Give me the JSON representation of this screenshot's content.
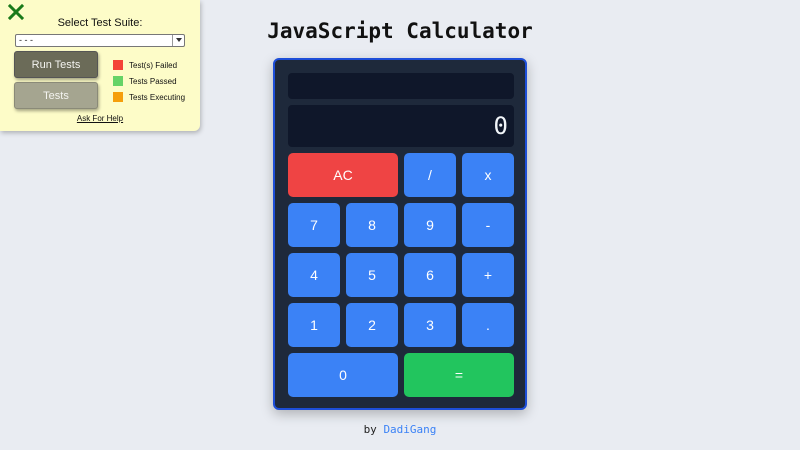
{
  "test_panel": {
    "title": "Select Test Suite:",
    "select_value": "- - -",
    "run_button": "Run Tests",
    "tests_button": "Tests",
    "legend": [
      {
        "label": "Test(s) Failed",
        "color": "#f44336"
      },
      {
        "label": "Tests Passed",
        "color": "#66d366"
      },
      {
        "label": "Tests Executing",
        "color": "#f59e0b"
      }
    ],
    "help_link": "Ask For Help",
    "close_icon": "close-x-icon",
    "close_color": "#1a7a1a"
  },
  "app": {
    "title": "JavaScript Calculator",
    "formula": "",
    "display": "0"
  },
  "keys": {
    "ac": "AC",
    "divide": "/",
    "multiply": "x",
    "seven": "7",
    "eight": "8",
    "nine": "9",
    "subtract": "-",
    "four": "4",
    "five": "5",
    "six": "6",
    "add": "+",
    "one": "1",
    "two": "2",
    "three": "3",
    "decimal": ".",
    "zero": "0",
    "equals": "="
  },
  "colors": {
    "calc_body": "#1e293b",
    "calc_border": "#1d4ed8",
    "key_blue": "#3b82f6",
    "key_red": "#ef4444",
    "key_green": "#22c55e"
  },
  "footer": {
    "prefix": "by",
    "author": "DadiGang"
  }
}
